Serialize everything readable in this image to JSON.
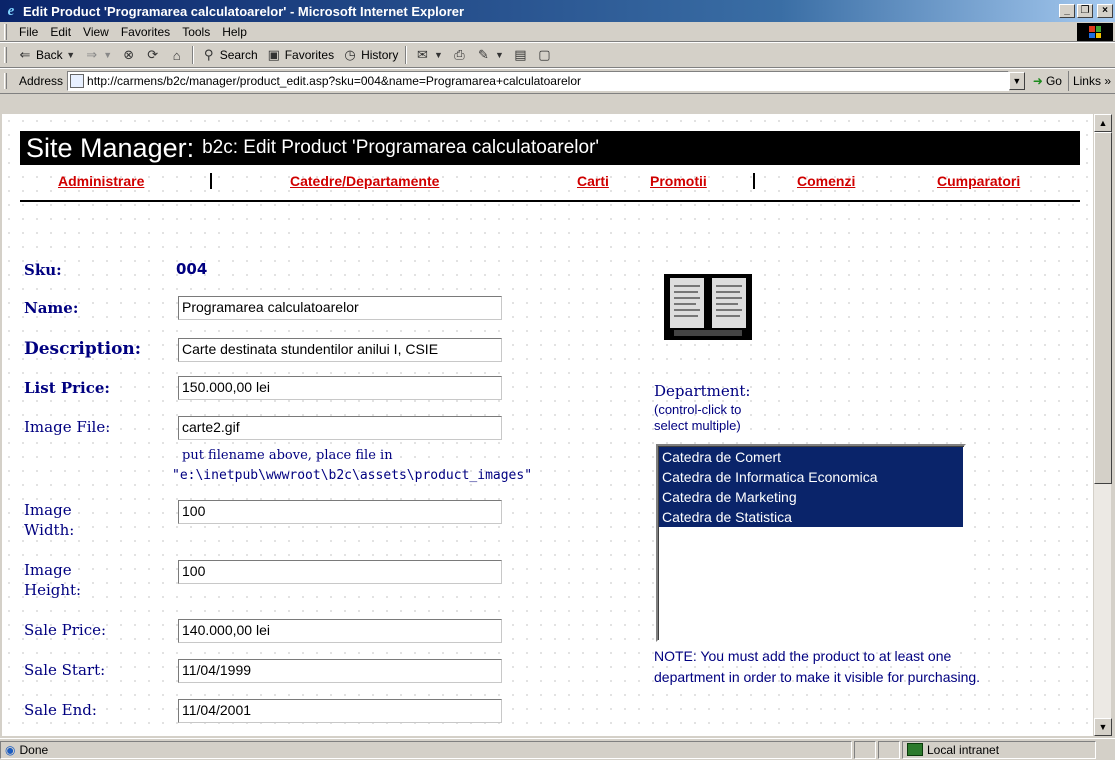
{
  "window": {
    "title": "Edit Product 'Programarea calculatoarelor' - Microsoft Internet Explorer",
    "min_glyph": "_",
    "max_glyph": "❐",
    "close_glyph": "×"
  },
  "menubar": {
    "items": [
      "File",
      "Edit",
      "View",
      "Favorites",
      "Tools",
      "Help"
    ]
  },
  "toolbar": {
    "back_label": "Back",
    "search_label": "Search",
    "favorites_label": "Favorites",
    "history_label": "History"
  },
  "addressbar": {
    "label": "Address",
    "url": "http://carmens/b2c/manager/product_edit.asp?sku=004&name=Programarea+calculatoarelor",
    "go_label": "Go",
    "links_label": "Links »"
  },
  "header": {
    "title_main": "Site Manager:",
    "title_sub": "b2c: Edit Product 'Programarea calculatoarelor'"
  },
  "nav": {
    "items": [
      "Administrare",
      "Catedre/Departamente",
      "Carti",
      "Promotii",
      "Comenzi",
      "Cumparatori"
    ]
  },
  "form": {
    "sku_label": "Sku:",
    "sku_value": "004",
    "name_label": "Name:",
    "name_value": "Programarea calculatoarelor",
    "description_label": "Description:",
    "description_value": "Carte destinata stundentilor anilui I, CSIE",
    "list_price_label": "List Price:",
    "list_price_value": "150.000,00 lei",
    "image_file_label": "Image File:",
    "image_file_value": "carte2.gif",
    "image_hint_1": "put filename above, place file in",
    "image_hint_2": "\"e:\\inetpub\\wwwroot\\b2c\\assets\\product_images\"",
    "image_width_label_1": "Image",
    "image_width_label_2": "Width:",
    "image_width_value": "100",
    "image_height_label_1": "Image",
    "image_height_label_2": "Height:",
    "image_height_value": "100",
    "sale_price_label": "Sale Price:",
    "sale_price_value": "140.000,00 lei",
    "sale_start_label": "Sale Start:",
    "sale_start_value": "11/04/1999",
    "sale_end_label": "Sale End:",
    "sale_end_value": "11/04/2001"
  },
  "department": {
    "label": "Department:",
    "sub_1": "(control-click to",
    "sub_2": "select multiple)",
    "options": [
      "Catedra de Comert",
      "Catedra de Informatica Economica",
      "Catedra de Marketing",
      "Catedra de Statistica"
    ],
    "note_1": "NOTE: You must add the product to at least one",
    "note_2": "department in order to make it visible for purchasing."
  },
  "statusbar": {
    "status": "Done",
    "zone": "Local intranet"
  },
  "colors": {
    "nav_link": "#d00000",
    "label_navy": "#000080",
    "selection": "#0a246a"
  }
}
